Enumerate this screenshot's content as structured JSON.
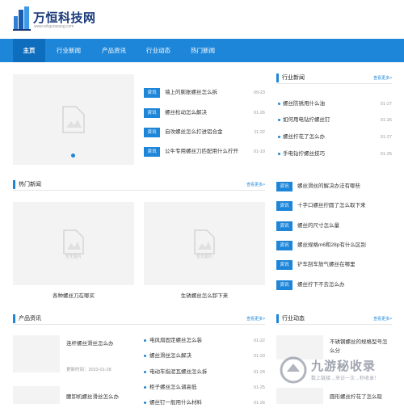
{
  "brand": {
    "name": "万恒科技网",
    "url": "www.whguowang.com"
  },
  "nav": [
    {
      "label": "主页",
      "active": true
    },
    {
      "label": "行业新闻"
    },
    {
      "label": "产品资讯"
    },
    {
      "label": "行业动态"
    },
    {
      "label": "热门新闻"
    }
  ],
  "top_news": [
    {
      "tag": "资讯",
      "title": "墙上的膨胀螺丝怎么拆",
      "date": "09-23"
    },
    {
      "tag": "资讯",
      "title": "螺丝松动怎么解决",
      "date": "01-26"
    },
    {
      "tag": "资讯",
      "title": "自攻螺丝怎么打进铝合金",
      "date": "11-22"
    },
    {
      "tag": "资讯",
      "title": "公牛专用螺丝刀匹配用什么拧开",
      "date": "01-10"
    }
  ],
  "industry_news": {
    "title": "行业新闻",
    "more": "查看更多>",
    "links": [
      {
        "title": "螺丝防锈用什么油",
        "date": "01-27"
      },
      {
        "title": "如何用电钻拧螺丝钉",
        "date": "01-26"
      },
      {
        "title": "螺丝拧花了怎么办",
        "date": "01-27"
      },
      {
        "title": "手电钻拧螺丝技巧",
        "date": "01-25"
      }
    ],
    "tagged": [
      {
        "tag": "资讯",
        "title": "螺丝滑丝的解决办法有哪些"
      },
      {
        "tag": "资讯",
        "title": "十字口螺丝拧圆了怎么取下来"
      },
      {
        "tag": "资讯",
        "title": "螺丝的尺寸怎么量"
      },
      {
        "tag": "资讯",
        "title": "螺丝规格m6和28p有什么区别"
      },
      {
        "tag": "资讯",
        "title": "铲车刮车放气螺丝在哪里"
      },
      {
        "tag": "资讯",
        "title": "螺丝拧下不去怎么办"
      }
    ]
  },
  "hot_news": {
    "title": "热门新闻",
    "more": "查看更多>",
    "items": [
      {
        "caption": "各种螺丝刀在哪买"
      },
      {
        "caption": "生锈螺丝怎么卸下来"
      }
    ]
  },
  "placeholder_label": "暂无图片",
  "product_news": {
    "title": "产品资讯",
    "more": "查看更多>",
    "items": [
      {
        "title": "连杆螺丝滑丝怎么办",
        "date": "更新时间：2023-01-28"
      },
      {
        "title": "腰卸机螺丝滑丝怎么办",
        "date": ""
      }
    ],
    "list": [
      {
        "title": "电风扇固定螺丝怎么装",
        "date": "01-22"
      },
      {
        "title": "螺丝滑丝怎么解决",
        "date": "01-23"
      },
      {
        "title": "电动车指泥瓦螺丝怎么拆",
        "date": "01-24"
      },
      {
        "title": "柜子螺丝怎么调高低",
        "date": "01-25"
      },
      {
        "title": "螺丝钉一般用什么材料",
        "date": "01-26"
      }
    ]
  },
  "industry_dynamics": {
    "title": "行业动态",
    "more": "查看更多>",
    "items": [
      {
        "title": "不锈钢螺丝的规格型号怎么分"
      },
      {
        "title": "圆形螺丝拧花了怎么取"
      }
    ]
  },
  "watermark": {
    "text": "九游秘收录",
    "sub": "数上链接→来访一次→秒收录！"
  }
}
